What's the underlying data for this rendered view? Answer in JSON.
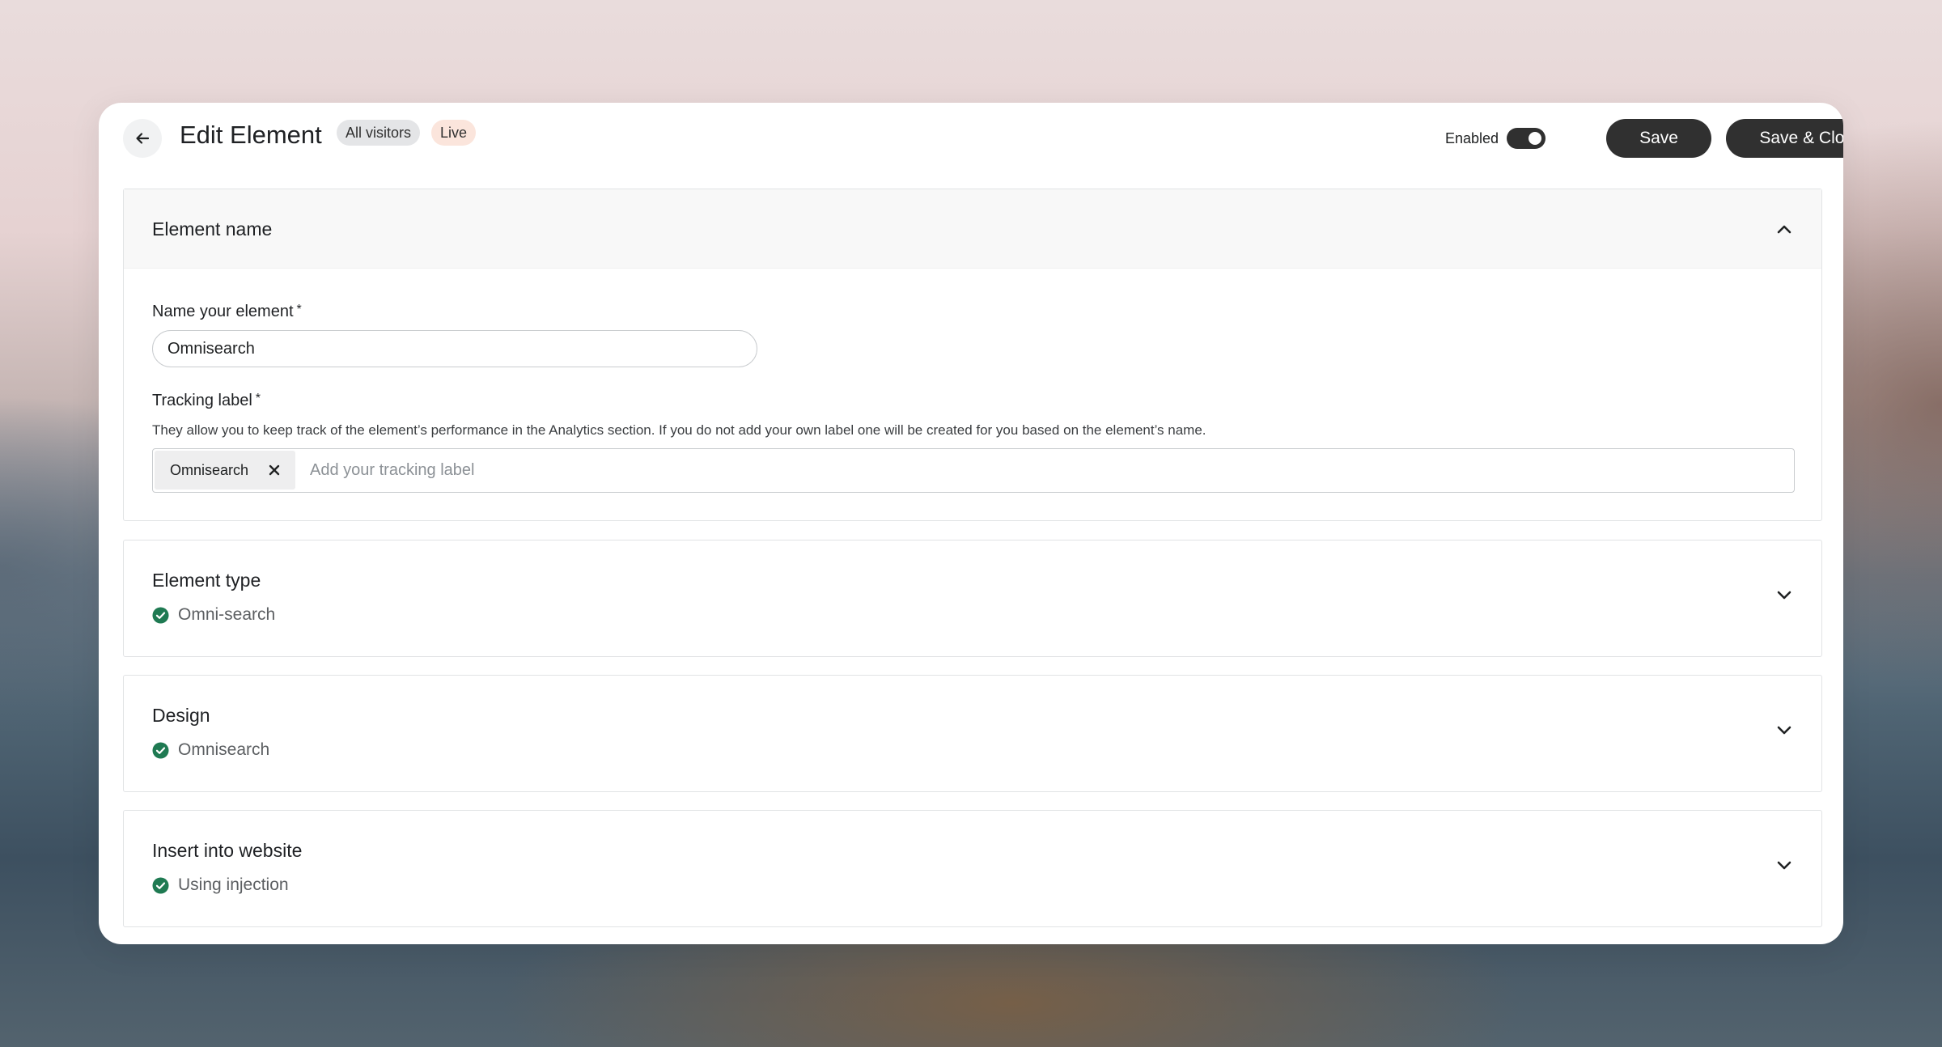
{
  "header": {
    "title": "Edit Element",
    "badges": [
      "All visitors",
      "Live"
    ],
    "enabled_label": "Enabled",
    "enabled": true,
    "save_label": "Save",
    "save_close_label": "Save & Close"
  },
  "element_name_section": {
    "title": "Element name",
    "expanded": true,
    "name_field": {
      "label": "Name your element",
      "required_mark": "*",
      "value": "Omnisearch"
    },
    "tracking_field": {
      "label": "Tracking label",
      "required_mark": "*",
      "help": "They allow you to keep track of the element’s performance in the Analytics section. If you do not add your own label one will be created for you based on the element’s name.",
      "tags": [
        "Omnisearch"
      ],
      "placeholder": "Add your tracking label"
    }
  },
  "sections": [
    {
      "title": "Element type",
      "status": "Omni-search"
    },
    {
      "title": "Design",
      "status": "Omnisearch"
    },
    {
      "title": "Insert into website",
      "status": "Using injection"
    }
  ],
  "colors": {
    "accent_dark": "#303030",
    "success": "#1f7a52",
    "live_badge": "#fbe5dc",
    "visitors_badge": "#e4e5e7"
  },
  "icons": {
    "back": "arrow-left-icon",
    "more": "vertical-dots-icon",
    "collapse": "chevron-up-icon",
    "expand": "chevron-down-icon",
    "remove_tag": "close-icon",
    "status": "check-circle-icon"
  }
}
